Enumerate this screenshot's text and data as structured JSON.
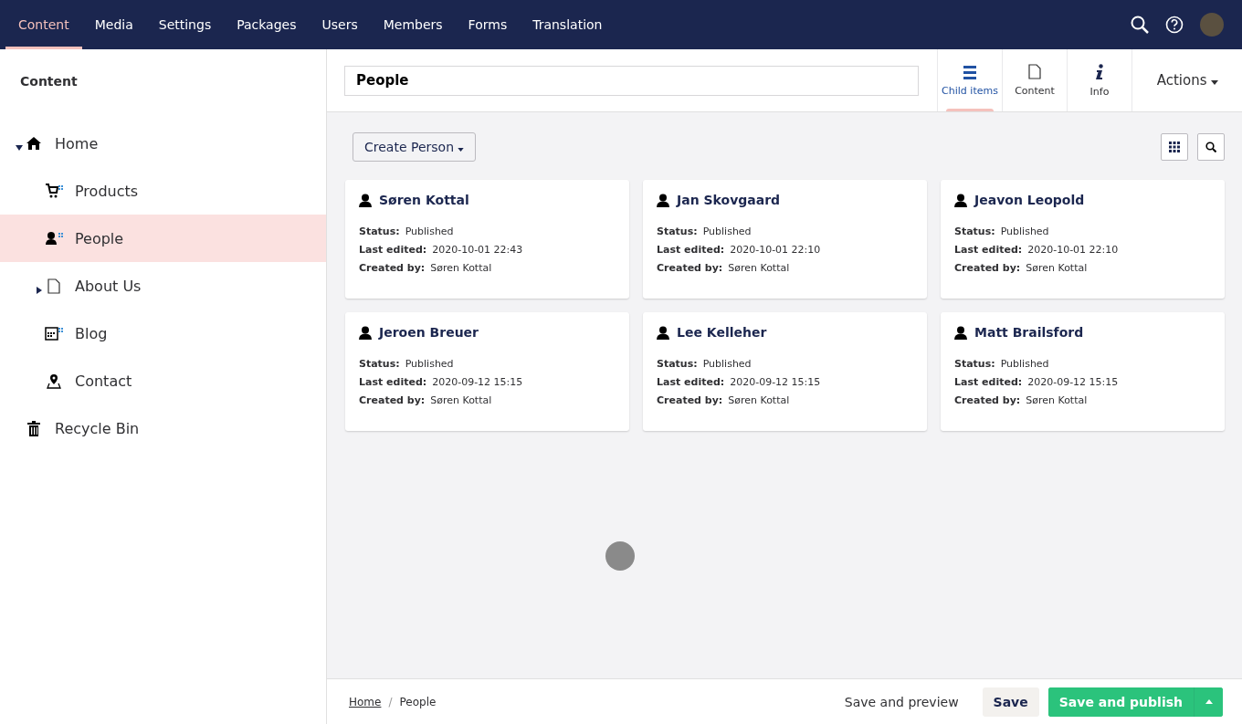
{
  "top_nav": {
    "items": [
      {
        "label": "Content",
        "selected": true
      },
      {
        "label": "Media",
        "selected": false
      },
      {
        "label": "Settings",
        "selected": false
      },
      {
        "label": "Packages",
        "selected": false
      },
      {
        "label": "Users",
        "selected": false
      },
      {
        "label": "Members",
        "selected": false
      },
      {
        "label": "Forms",
        "selected": false
      },
      {
        "label": "Translation",
        "selected": false
      }
    ]
  },
  "sidebar": {
    "title": "Content",
    "tree": [
      {
        "label": "Home",
        "kind": "home",
        "expanded": true,
        "selected": false,
        "children": [
          {
            "label": "Products",
            "kind": "cart",
            "selected": false
          },
          {
            "label": "People",
            "kind": "people",
            "selected": true
          },
          {
            "label": "About Us",
            "kind": "document",
            "expanded": false,
            "selected": false
          },
          {
            "label": "Blog",
            "kind": "blog",
            "selected": false
          },
          {
            "label": "Contact",
            "kind": "pin",
            "selected": false
          }
        ]
      },
      {
        "label": "Recycle Bin",
        "kind": "trash",
        "selected": false
      }
    ]
  },
  "editor": {
    "name": "People",
    "apps": [
      {
        "label": "Child items",
        "kind": "list",
        "selected": true
      },
      {
        "label": "Content",
        "kind": "document",
        "selected": false
      },
      {
        "label": "Info",
        "kind": "info",
        "selected": false
      }
    ],
    "actions": "Actions"
  },
  "toolbar": {
    "create_button": "Create Person"
  },
  "cards": [
    {
      "name": "Søren Kottal",
      "status_label": "Status:",
      "status": "Published",
      "edited_label": "Last edited:",
      "edited": "2020-10-01 22:43",
      "created_label": "Created by:",
      "created_by": "Søren Kottal"
    },
    {
      "name": "Jan Skovgaard",
      "status_label": "Status:",
      "status": "Published",
      "edited_label": "Last edited:",
      "edited": "2020-10-01 22:10",
      "created_label": "Created by:",
      "created_by": "Søren Kottal"
    },
    {
      "name": "Jeavon Leopold",
      "status_label": "Status:",
      "status": "Published",
      "edited_label": "Last edited:",
      "edited": "2020-10-01 22:10",
      "created_label": "Created by:",
      "created_by": "Søren Kottal"
    },
    {
      "name": "Jeroen Breuer",
      "status_label": "Status:",
      "status": "Published",
      "edited_label": "Last edited:",
      "edited": "2020-09-12 15:15",
      "created_label": "Created by:",
      "created_by": "Søren Kottal"
    },
    {
      "name": "Lee Kelleher",
      "status_label": "Status:",
      "status": "Published",
      "edited_label": "Last edited:",
      "edited": "2020-09-12 15:15",
      "created_label": "Created by:",
      "created_by": "Søren Kottal"
    },
    {
      "name": "Matt Brailsford",
      "status_label": "Status:",
      "status": "Published",
      "edited_label": "Last edited:",
      "edited": "2020-09-12 15:15",
      "created_label": "Created by:",
      "created_by": "Søren Kottal"
    }
  ],
  "footer": {
    "breadcrumb": [
      {
        "label": "Home",
        "kind": "link"
      },
      {
        "label": "/",
        "kind": "separator"
      },
      {
        "label": "People",
        "kind": "current"
      }
    ],
    "buttons": [
      {
        "label": "Save and preview",
        "kind": "link"
      },
      {
        "label": "Save",
        "kind": "secondary"
      },
      {
        "label": "Save and publish",
        "kind": "primary"
      }
    ]
  }
}
